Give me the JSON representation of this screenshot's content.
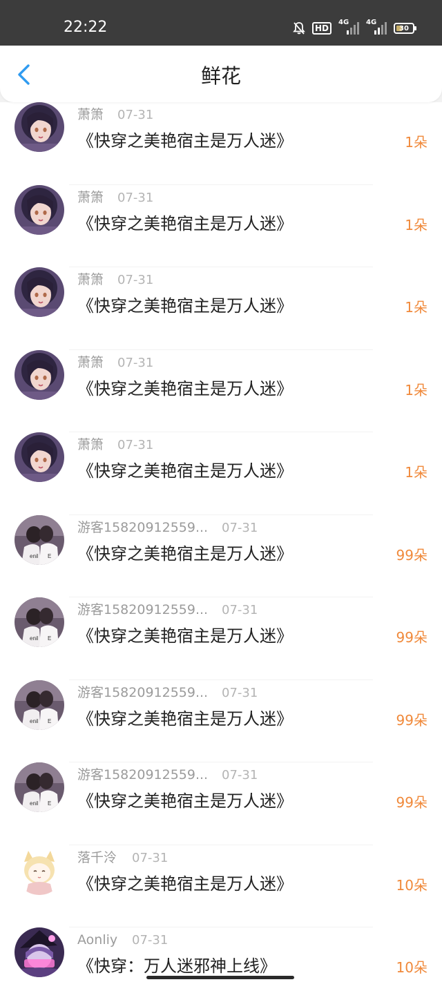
{
  "status": {
    "time": "22:22",
    "hd": "HD",
    "network": "4G",
    "battery": "30",
    "icons": [
      "bell-off-icon",
      "hd-icon",
      "signal-icon",
      "signal-icon",
      "battery-icon"
    ]
  },
  "header": {
    "title": "鲜花",
    "back_icon": "chevron-left-icon",
    "accent": "#2f9bf0"
  },
  "list": [
    {
      "user": "萧箫",
      "date": "07-31",
      "book": "《快穿之美艳宿主是万人迷》",
      "amount": "1朵",
      "avatar": "girl-dark-hair"
    },
    {
      "user": "萧箫",
      "date": "07-31",
      "book": "《快穿之美艳宿主是万人迷》",
      "amount": "1朵",
      "avatar": "girl-dark-hair"
    },
    {
      "user": "萧箫",
      "date": "07-31",
      "book": "《快穿之美艳宿主是万人迷》",
      "amount": "1朵",
      "avatar": "girl-dark-hair"
    },
    {
      "user": "萧箫",
      "date": "07-31",
      "book": "《快穿之美艳宿主是万人迷》",
      "amount": "1朵",
      "avatar": "girl-dark-hair"
    },
    {
      "user": "萧箫",
      "date": "07-31",
      "book": "《快穿之美艳宿主是万人迷》",
      "amount": "1朵",
      "avatar": "girl-dark-hair"
    },
    {
      "user": "游客15820912559...",
      "date": "07-31",
      "book": "《快穿之美艳宿主是万人迷》",
      "amount": "99朵",
      "avatar": "couple-photo"
    },
    {
      "user": "游客15820912559...",
      "date": "07-31",
      "book": "《快穿之美艳宿主是万人迷》",
      "amount": "99朵",
      "avatar": "couple-photo"
    },
    {
      "user": "游客15820912559...",
      "date": "07-31",
      "book": "《快穿之美艳宿主是万人迷》",
      "amount": "99朵",
      "avatar": "couple-photo"
    },
    {
      "user": "游客15820912559...",
      "date": "07-31",
      "book": "《快穿之美艳宿主是万人迷》",
      "amount": "99朵",
      "avatar": "couple-photo"
    },
    {
      "user": "落千泠",
      "date": "07-31",
      "book": "《快穿之美艳宿主是万人迷》",
      "amount": "10朵",
      "avatar": "anime-cat-girl"
    },
    {
      "user": "Aonliy",
      "date": "07-31",
      "book": "《快穿：万人迷邪神上线》",
      "amount": "10朵",
      "avatar": "anime-purple"
    }
  ],
  "colors": {
    "amount": "#f0893a",
    "username": "#9b9b9b",
    "date": "#b4b4b4",
    "statusbar": "#3c3c3c"
  }
}
